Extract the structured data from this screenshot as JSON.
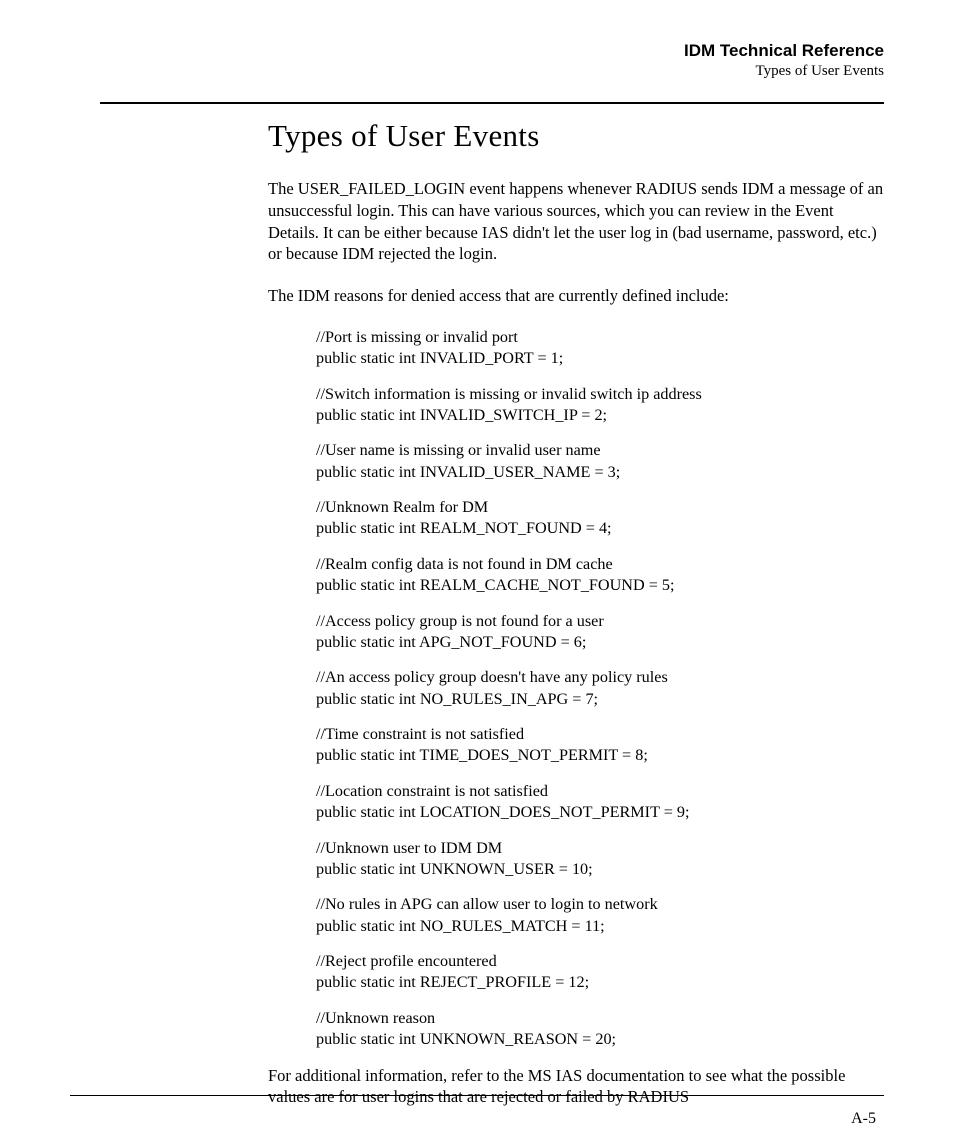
{
  "header": {
    "title": "IDM Technical Reference",
    "subtitle": "Types of User Events"
  },
  "section_heading": "Types of User Events",
  "intro_paragraph": "The USER_FAILED_LOGIN event happens whenever RADIUS sends IDM a message of an unsuccessful login. This can have various sources, which you can review in the Event Details. It can be either because IAS didn't let the user log in (bad username, password, etc.) or because IDM rejected the login.",
  "reasons_intro": "The IDM reasons for denied access that are currently defined include:",
  "definitions": [
    {
      "comment": "//Port is missing or invalid port",
      "decl": "public static int INVALID_PORT = 1;"
    },
    {
      "comment": "//Switch information is missing or invalid switch ip address",
      "decl": "public static int INVALID_SWITCH_IP = 2;"
    },
    {
      "comment": "//User name is missing or invalid user name",
      "decl": "public static int INVALID_USER_NAME = 3;"
    },
    {
      "comment": "//Unknown Realm for DM",
      "decl": "public static int REALM_NOT_FOUND = 4;"
    },
    {
      "comment": "//Realm config data is not found in DM cache",
      "decl": "public static int REALM_CACHE_NOT_FOUND = 5;"
    },
    {
      "comment": "//Access policy group is not found for a user",
      "decl": "public static int APG_NOT_FOUND = 6;"
    },
    {
      "comment": "//An access policy group doesn't have any policy rules",
      "decl": "public static int NO_RULES_IN_APG = 7;"
    },
    {
      "comment": "//Time constraint is not satisfied",
      "decl": "public static int TIME_DOES_NOT_PERMIT = 8;"
    },
    {
      "comment": "//Location constraint is not satisfied",
      "decl": "public static int LOCATION_DOES_NOT_PERMIT = 9;"
    },
    {
      "comment": "//Unknown user to IDM DM",
      "decl": "public static int UNKNOWN_USER = 10;"
    },
    {
      "comment": "//No rules in APG can allow user to login to network",
      "decl": "public static int NO_RULES_MATCH = 11;"
    },
    {
      "comment": "//Reject profile encountered",
      "decl": "public static int REJECT_PROFILE = 12;"
    },
    {
      "comment": "//Unknown reason",
      "decl": "public static int UNKNOWN_REASON = 20;"
    }
  ],
  "closing_paragraph": "For additional information, refer to the MS IAS documentation to see what the possible values are for user logins that are rejected or failed by RADIUS",
  "page_number": "A-5"
}
